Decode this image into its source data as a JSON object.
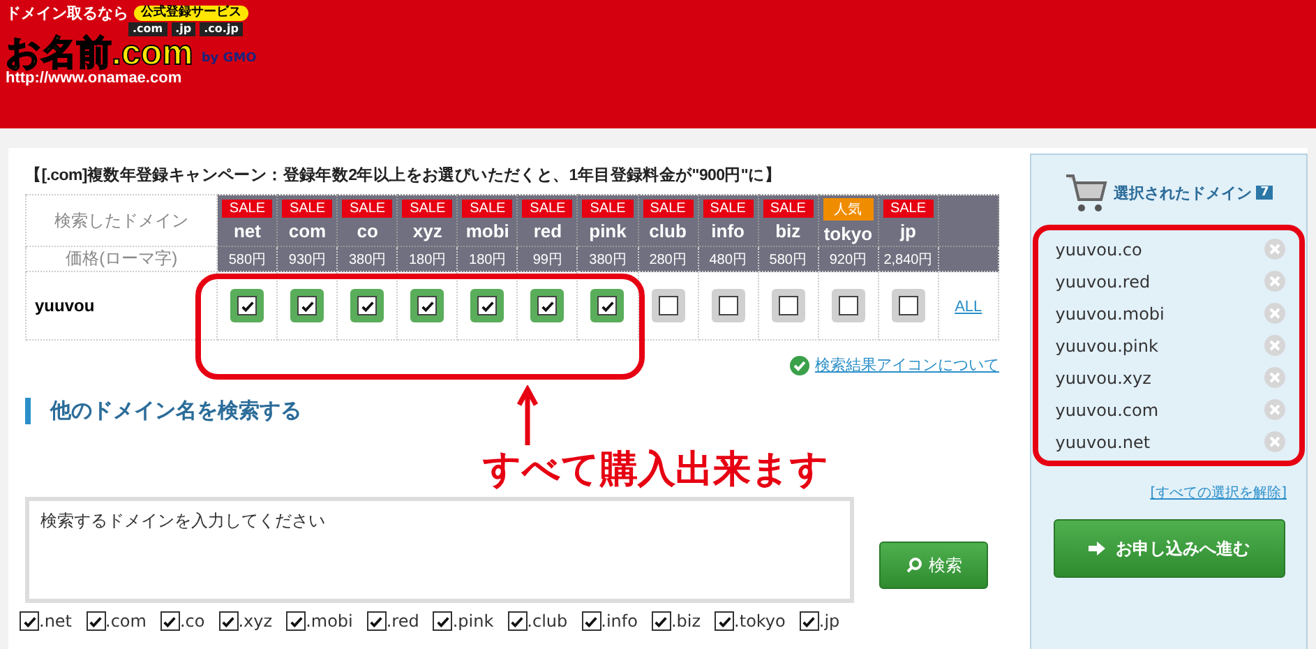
{
  "header": {
    "tagline": "ドメイン取るなら",
    "badge": "公式登録サービス",
    "tlds": [
      ".com",
      ".jp",
      ".co.jp"
    ],
    "logo": "お名前.com",
    "by": "by GMO",
    "url": "http://www.onamae.com"
  },
  "campaign": "【[.com]複数年登録キャンペーン：登録年数2年以上をお選びいただくと、1年目登録料金が\"900円\"に】",
  "table": {
    "search_label": "検索したドメイン",
    "price_label": "価格(ローマ字)",
    "name": "yuuvou",
    "all_link": "ALL",
    "domains": [
      {
        "badge": "SALE",
        "kind": "sale",
        "tld": "net",
        "price": "580円",
        "checked": true
      },
      {
        "badge": "SALE",
        "kind": "sale",
        "tld": "com",
        "price": "930円",
        "checked": true
      },
      {
        "badge": "SALE",
        "kind": "sale",
        "tld": "co",
        "price": "380円",
        "checked": true
      },
      {
        "badge": "SALE",
        "kind": "sale",
        "tld": "xyz",
        "price": "180円",
        "checked": true
      },
      {
        "badge": "SALE",
        "kind": "sale",
        "tld": "mobi",
        "price": "180円",
        "checked": true
      },
      {
        "badge": "SALE",
        "kind": "sale",
        "tld": "red",
        "price": "99円",
        "checked": true
      },
      {
        "badge": "SALE",
        "kind": "sale",
        "tld": "pink",
        "price": "380円",
        "checked": true
      },
      {
        "badge": "SALE",
        "kind": "sale",
        "tld": "club",
        "price": "280円",
        "checked": false
      },
      {
        "badge": "SALE",
        "kind": "sale",
        "tld": "info",
        "price": "480円",
        "checked": false
      },
      {
        "badge": "SALE",
        "kind": "sale",
        "tld": "biz",
        "price": "580円",
        "checked": false
      },
      {
        "badge": "人気",
        "kind": "popular",
        "tld": "tokyo",
        "price": "920円",
        "checked": false
      },
      {
        "badge": "SALE",
        "kind": "sale",
        "tld": "jp",
        "price": "2,840円",
        "checked": false
      }
    ]
  },
  "icon_help_link": "検索結果アイコンについて",
  "other_search": {
    "heading": "他のドメイン名を検索する",
    "placeholder": "検索するドメインを入力してください",
    "button": "検索",
    "options": [
      {
        "label": ".net",
        "checked": true
      },
      {
        "label": ".com",
        "checked": true
      },
      {
        "label": ".co",
        "checked": true
      },
      {
        "label": ".xyz",
        "checked": true
      },
      {
        "label": ".mobi",
        "checked": true
      },
      {
        "label": ".red",
        "checked": true
      },
      {
        "label": ".pink",
        "checked": true
      },
      {
        "label": ".club",
        "checked": true
      },
      {
        "label": ".info",
        "checked": true
      },
      {
        "label": ".biz",
        "checked": true
      },
      {
        "label": ".tokyo",
        "checked": true
      },
      {
        "label": ".jp",
        "checked": true
      }
    ]
  },
  "annotation": "すべて購入出来ます",
  "cart": {
    "title": "選択されたドメイン",
    "count": "7",
    "items": [
      "yuuvou.co",
      "yuuvou.red",
      "yuuvou.mobi",
      "yuuvou.pink",
      "yuuvou.xyz",
      "yuuvou.com",
      "yuuvou.net"
    ],
    "clear_link": "[すべての選択を解除]",
    "proceed": "お申し込みへ進む"
  }
}
